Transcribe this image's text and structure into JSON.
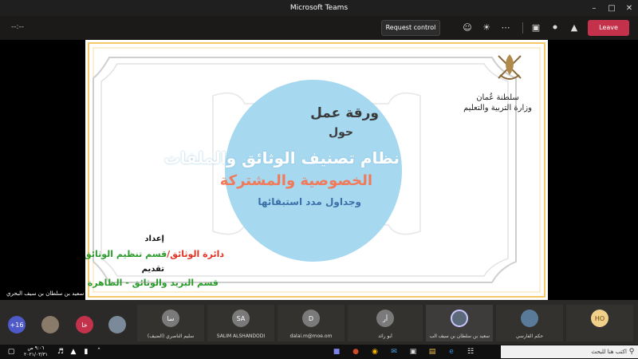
{
  "window": {
    "title": "Microsoft Teams"
  },
  "callbar": {
    "timer": "--:--",
    "request_control": "Request control",
    "leave": "Leave"
  },
  "slide": {
    "line1": "ورقة عمل",
    "line2": "حول",
    "line3": "نظام تصنيف الوثائق والملفات",
    "line4": "الخصوصية والمشتركة",
    "line5": "وجداول مدد استبقائها",
    "prepared_label": "إعداد",
    "prepared_by_red": "دائرة الوثائق/",
    "prepared_by_green": "قسم تنظيم الوثائق",
    "presented_label": "تقديم",
    "presented_by": "قسم البريد والوثائق - الظاهرة",
    "ministry_line1": "سلطنة عُمان",
    "ministry_line2": "وزارة التربية والتعليم"
  },
  "presenter_name": "سعيد بن سلطان بن سيف البحري",
  "participants": {
    "overflow": "+16",
    "small_initials": "خا",
    "tiles": [
      {
        "initials": "سا",
        "name": "سليم الناصري (الضيف)",
        "color": "#6b6b6b"
      },
      {
        "initials": "SA",
        "name": "SALIM ALSHANDODI",
        "color": "#6b6b6b"
      },
      {
        "initials": "D",
        "name": "dalai.m@moe.om",
        "color": "#6b6b6b"
      },
      {
        "initials": "أر",
        "name": "أبو رائد",
        "color": "#6b6b6b"
      },
      {
        "initials": "",
        "name": "سعيد بن سلطان بن سيف الب...",
        "color": "#5a5a5a"
      },
      {
        "initials": "",
        "name": "حكم الفارسي",
        "color": "#5a5a5a"
      },
      {
        "initials": "HO",
        "name": "",
        "color": "#f1d08a"
      }
    ]
  },
  "taskbar": {
    "search_placeholder": "اكتب هنا للبحث",
    "time": "٩:٠٦ ص",
    "date": "٢٠٢١/٠٣/٣١"
  }
}
